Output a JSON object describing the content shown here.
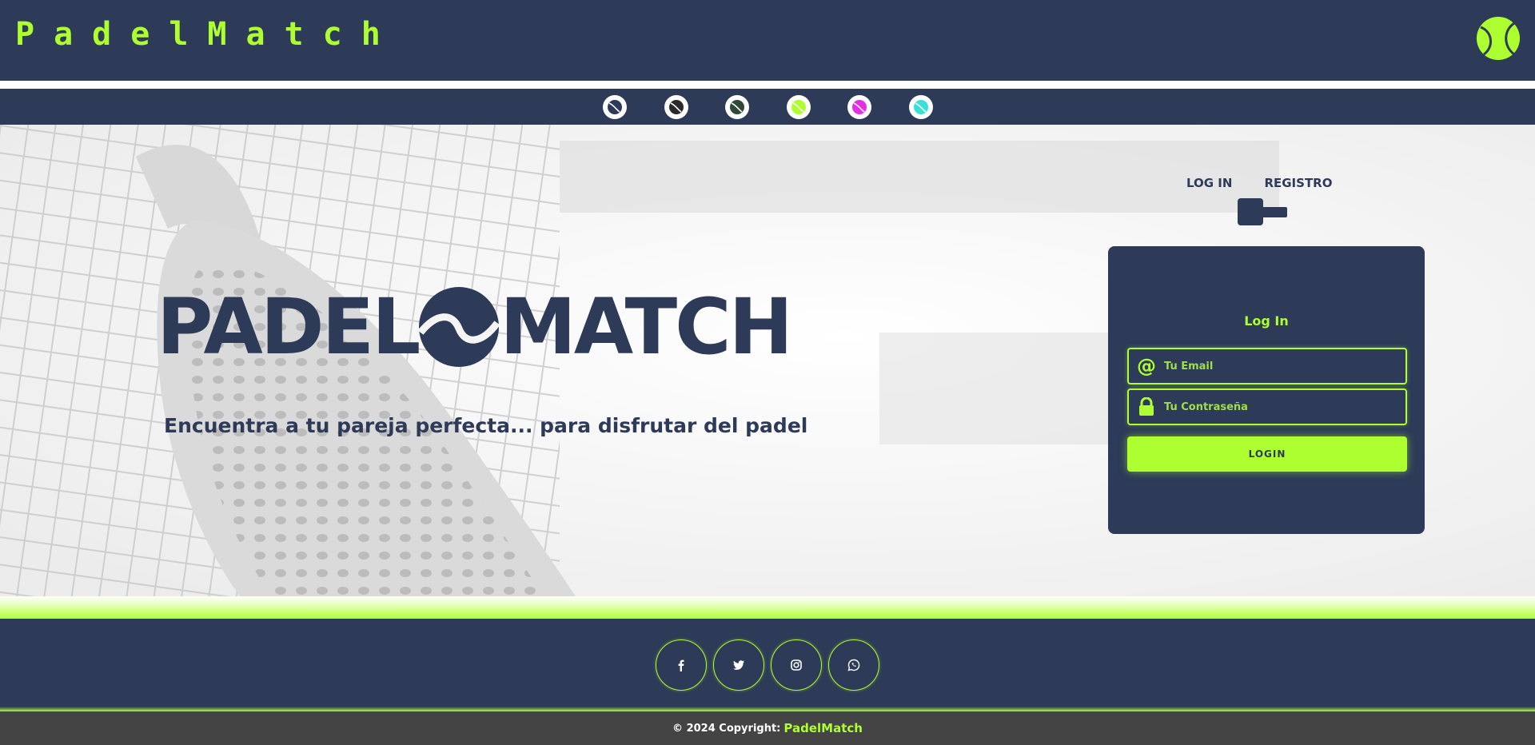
{
  "header": {
    "brand": "PadelMatch",
    "logo_icon": "tennis-ball-icon"
  },
  "themes": [
    {
      "name": "navy",
      "color": "#2d3a58"
    },
    {
      "name": "dark",
      "color": "#2a2a2a"
    },
    {
      "name": "green",
      "color": "#2e4a36"
    },
    {
      "name": "lime",
      "color": "#adff2f"
    },
    {
      "name": "magenta",
      "color": "#e52ee5"
    },
    {
      "name": "cyan",
      "color": "#38e0d8"
    }
  ],
  "hero": {
    "logo_left": "PADEL",
    "logo_right": "MATCH",
    "tagline": "Encuentra a tu pareja perfecta... para disfrutar del padel"
  },
  "auth": {
    "tabs": {
      "login": "LOG IN",
      "register": "REGISTRO"
    },
    "card_title": "Log In",
    "email_placeholder": "Tu Email",
    "password_placeholder": "Tu Contraseña",
    "login_button": "LOGIN"
  },
  "footer": {
    "socials": [
      "facebook-icon",
      "twitter-icon",
      "instagram-icon",
      "whatsapp-icon"
    ],
    "copyright_prefix": "© 2024 Copyright:",
    "copyright_brand": "PadelMatch"
  },
  "colors": {
    "primary": "#2d3a58",
    "accent": "#adff2f",
    "copyright_bg": "#444444"
  }
}
